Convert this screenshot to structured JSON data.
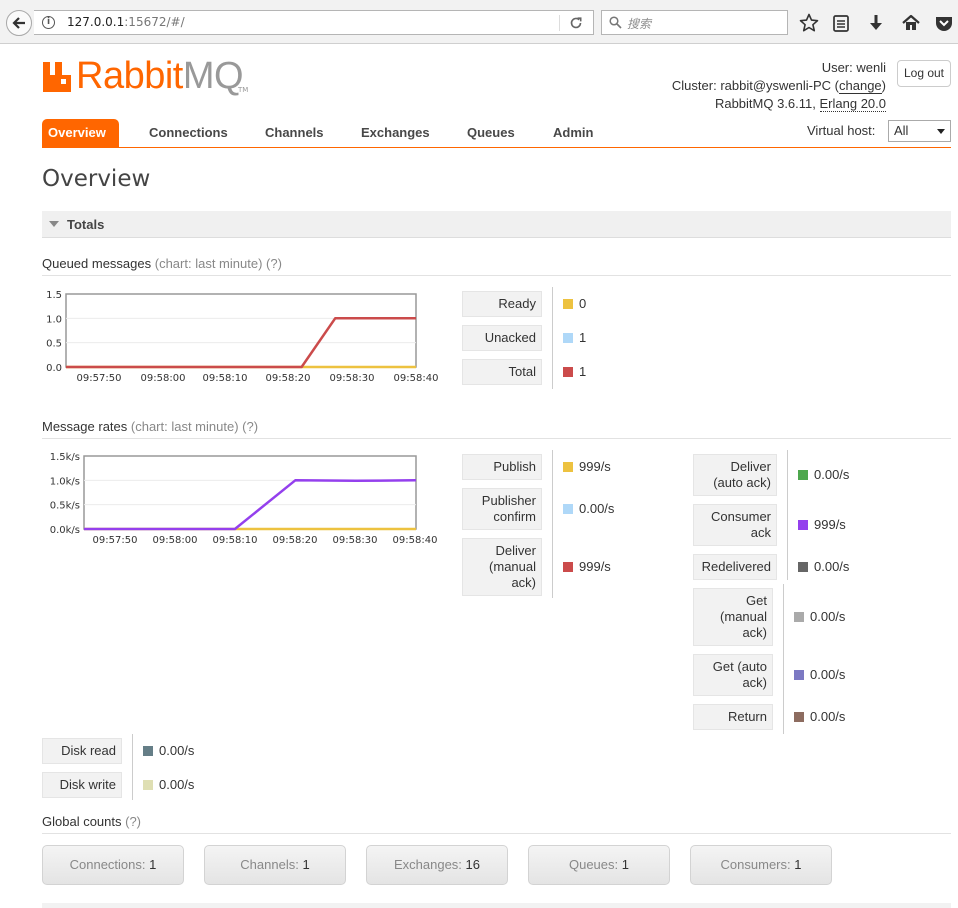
{
  "browser": {
    "url_host": "127.0.0.1",
    "url_rest": ":15672/#/",
    "search_placeholder": "搜索"
  },
  "header": {
    "logo_text_a": "Rabbit",
    "logo_text_b": "MQ",
    "logo_tm": "TM",
    "user_label": "User:",
    "user_name": "wenli",
    "cluster_label": "Cluster:",
    "cluster_name": "rabbit@yswenli-PC",
    "change_link": "change",
    "version": "RabbitMQ 3.6.11,",
    "erlang": "Erlang 20.0",
    "logout": "Log out"
  },
  "nav": {
    "tabs": [
      "Overview",
      "Connections",
      "Channels",
      "Exchanges",
      "Queues",
      "Admin"
    ],
    "active": "Overview",
    "vhost_label": "Virtual host:",
    "vhost_value": "All"
  },
  "page_title": "Overview",
  "totals_label": "Totals",
  "queued": {
    "heading": "Queued messages",
    "heading_dim": "(chart: last minute) (?)",
    "legend": [
      {
        "label": "Ready",
        "value": "0",
        "color": "#edc240"
      },
      {
        "label": "Unacked",
        "value": "1",
        "color": "#afd8f8"
      },
      {
        "label": "Total",
        "value": "1",
        "color": "#cb4b4b"
      }
    ]
  },
  "rates": {
    "heading": "Message rates",
    "heading_dim": "(chart: last minute) (?)",
    "left": [
      {
        "label": "Publish",
        "value": "999/s",
        "color": "#edc240"
      },
      {
        "label": "Publisher confirm",
        "value": "0.00/s",
        "color": "#afd8f8"
      },
      {
        "label": "Deliver (manual ack)",
        "value": "999/s",
        "color": "#cb4b4b"
      }
    ],
    "right": [
      {
        "label": "Deliver (auto ack)",
        "value": "0.00/s",
        "color": "#4da74d"
      },
      {
        "label": "Consumer ack",
        "value": "999/s",
        "color": "#9440ed"
      },
      {
        "label": "Redelivered",
        "value": "0.00/s",
        "color": "#666666"
      },
      {
        "label": "Get (manual ack)",
        "value": "0.00/s",
        "color": "#aaaaaa"
      },
      {
        "label": "Get (auto ack)",
        "value": "0.00/s",
        "color": "#7c79c3"
      },
      {
        "label": "Return",
        "value": "0.00/s",
        "color": "#8d6c60"
      }
    ],
    "disk": [
      {
        "label": "Disk read",
        "value": "0.00/s",
        "color": "#657e87"
      },
      {
        "label": "Disk write",
        "value": "0.00/s",
        "color": "#dfdfb3"
      }
    ]
  },
  "global": {
    "heading": "Global counts",
    "heading_dim": "(?)",
    "counts": [
      {
        "label": "Connections:",
        "value": "1"
      },
      {
        "label": "Channels:",
        "value": "1"
      },
      {
        "label": "Exchanges:",
        "value": "16"
      },
      {
        "label": "Queues:",
        "value": "1"
      },
      {
        "label": "Consumers:",
        "value": "1"
      }
    ]
  },
  "chart_data": [
    {
      "type": "line",
      "x": [
        "09:57:50",
        "09:58:00",
        "09:58:10",
        "09:58:20",
        "09:58:30",
        "09:58:40"
      ],
      "ylim": [
        0,
        1.5
      ],
      "yticks": [
        "0.0",
        "0.5",
        "1.0",
        "1.5"
      ],
      "series": [
        {
          "name": "Ready",
          "color": "#edc240",
          "points": [
            [
              0,
              0
            ],
            [
              52,
              0
            ]
          ]
        },
        {
          "name": "Total",
          "color": "#cb4b4b",
          "points": [
            [
              0,
              0
            ],
            [
              35,
              0
            ],
            [
              40,
              1
            ],
            [
              52,
              1
            ]
          ]
        }
      ]
    },
    {
      "type": "line",
      "x": [
        "09:57:50",
        "09:58:00",
        "09:58:10",
        "09:58:20",
        "09:58:30",
        "09:58:40"
      ],
      "ylim": [
        0,
        1500
      ],
      "yticks": [
        "0.0k/s",
        "0.5k/s",
        "1.0k/s",
        "1.5k/s"
      ],
      "series": [
        {
          "name": "Publish",
          "color": "#edc240",
          "points": [
            [
              0,
              0
            ],
            [
              55,
              0
            ]
          ]
        },
        {
          "name": "Consumer ack",
          "color": "#9440ed",
          "points": [
            [
              0,
              0
            ],
            [
              25,
              0
            ],
            [
              35,
              1000
            ],
            [
              45,
              990
            ],
            [
              55,
              1000
            ]
          ]
        }
      ]
    }
  ]
}
